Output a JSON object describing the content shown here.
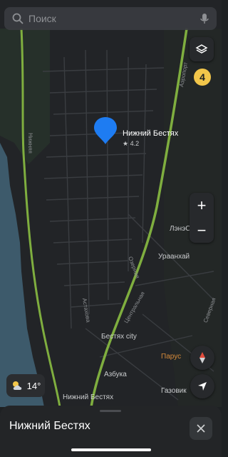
{
  "search": {
    "placeholder": "Поиск"
  },
  "controls": {
    "traffic_level": "4",
    "zoom_in": "+",
    "zoom_out": "−"
  },
  "weather": {
    "temperature": "14°"
  },
  "map": {
    "place_name": "Нижний Бестях",
    "rating": "★ 4.2",
    "pois": {
      "lenstroy": "ЛэнэСтрой",
      "urankhai": "Ураанхай",
      "bestyakh_city": "Бестях city",
      "azbuka": "Азбука",
      "nizhny_bestyakh_stop": "Нижний Бестях",
      "parus": "Парус",
      "gazovik": "Газовик"
    },
    "streets": {
      "nizhnyaya": "Нижняя",
      "ozernaya": "Озерная",
      "tsentralnaya": "Центральная",
      "aeroport": "Аэропорт",
      "severnaya": "Северная",
      "astakhova": "Астахова"
    }
  },
  "sheet": {
    "title": "Нижний Бестях"
  },
  "colors": {
    "accent_pin": "#1e7cf2",
    "road_highway": "#7fae3f",
    "traffic_badge": "#f2c64a",
    "water": "#3d5a6b"
  }
}
